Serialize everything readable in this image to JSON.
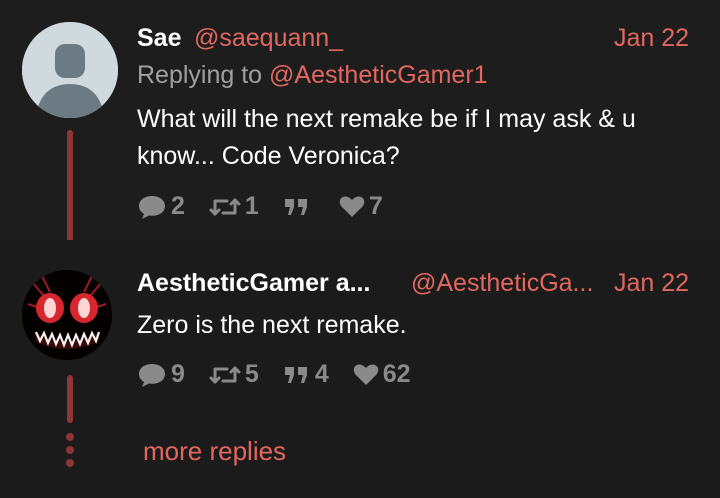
{
  "tweets": [
    {
      "name": "Sae",
      "handle": "@saequann_",
      "date": "Jan 22",
      "replying_label": "Replying to ",
      "replying_to": "@AestheticGamer1",
      "text_line1": "What will the next remake be if I may ask & u",
      "text_line2": "know... Code Veronica?",
      "replies": "2",
      "retweets": "1",
      "quotes": "",
      "likes": "7"
    },
    {
      "name": "AestheticGamer a...",
      "handle": "@AestheticGa...",
      "date": "Jan 22",
      "text_line1": "Zero is the next remake.",
      "replies": "9",
      "retweets": "5",
      "quotes": "4",
      "likes": "62"
    }
  ],
  "more_replies": "more replies",
  "colors": {
    "accent": "#e2675f",
    "thread_line": "#8e3636",
    "muted": "#8a8a8a",
    "background": "#1b1b1b"
  },
  "icons": [
    "reply-icon",
    "retweet-icon",
    "quote-icon",
    "like-icon",
    "default-avatar-icon"
  ]
}
